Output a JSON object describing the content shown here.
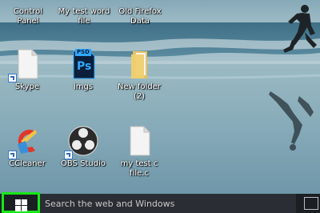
{
  "desktop": {
    "top_row": [
      {
        "label_line1": "Control",
        "label_line2": "Panel"
      },
      {
        "label_line1": "My test word",
        "label_line2": "file"
      },
      {
        "label_line1": "Old Firefox",
        "label_line2": "Data"
      }
    ],
    "icons": [
      {
        "label_line1": "Skype",
        "label_line2": ""
      },
      {
        "label_line1": "imgs",
        "label_line2": "",
        "badge": "PSD",
        "glyph_text": "Ps"
      },
      {
        "label_line1": "New folder",
        "label_line2": "(2)"
      },
      {
        "label_line1": "CCleaner",
        "label_line2": ""
      },
      {
        "label_line1": "OBS Studio",
        "label_line2": ""
      },
      {
        "label_line1": "my test c",
        "label_line2": "file.c"
      }
    ]
  },
  "taskbar": {
    "search_placeholder": "Search the web and Windows"
  },
  "colors": {
    "highlight": "#19e619",
    "taskbar": "#1b1f24"
  }
}
